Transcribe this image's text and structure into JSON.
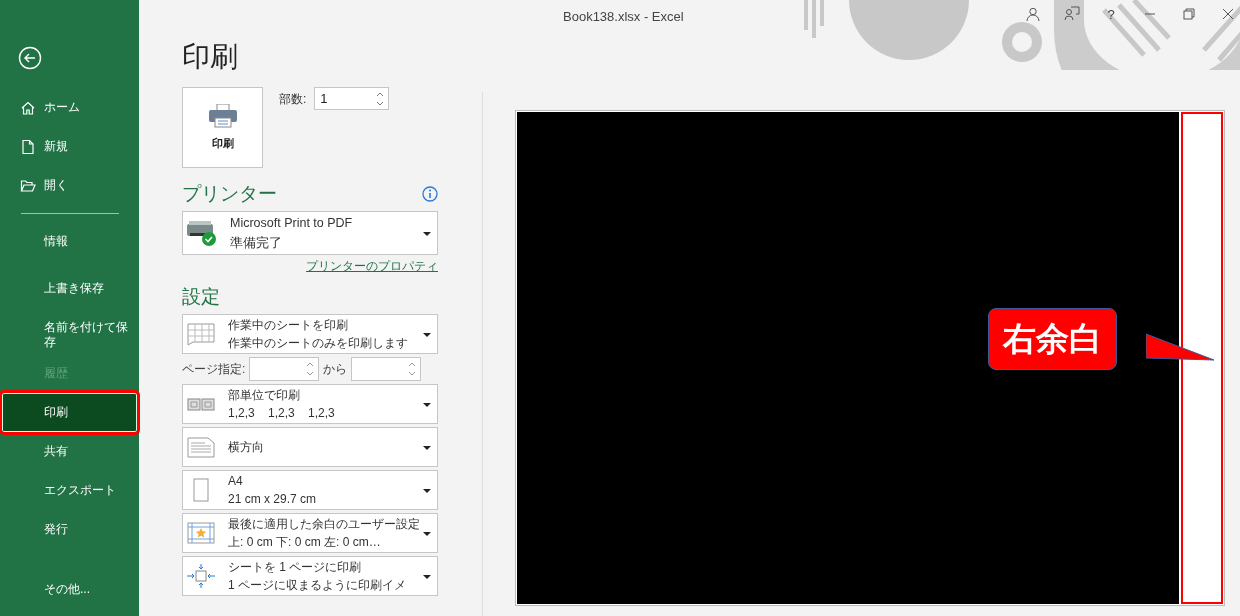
{
  "window": {
    "title": "Book138.xlsx  -  Excel",
    "help_label": "?"
  },
  "sidebar": {
    "items": [
      {
        "kind": "home",
        "label": "ホーム",
        "disabled": false,
        "selected": false
      },
      {
        "kind": "new",
        "label": "新規",
        "disabled": false,
        "selected": false
      },
      {
        "kind": "open",
        "label": "開く",
        "disabled": false,
        "selected": false
      },
      {
        "kind": "plain",
        "label": "情報",
        "disabled": false,
        "selected": false
      },
      {
        "kind": "plain",
        "label": "上書き保存",
        "disabled": false,
        "selected": false
      },
      {
        "kind": "plain",
        "label": "名前を付けて保存",
        "disabled": false,
        "selected": false
      },
      {
        "kind": "plain",
        "label": "履歴",
        "disabled": true,
        "selected": false
      },
      {
        "kind": "plain",
        "label": "印刷",
        "disabled": false,
        "selected": true
      },
      {
        "kind": "plain",
        "label": "共有",
        "disabled": false,
        "selected": false
      },
      {
        "kind": "plain",
        "label": "エクスポート",
        "disabled": false,
        "selected": false
      },
      {
        "kind": "plain",
        "label": "発行",
        "disabled": false,
        "selected": false
      },
      {
        "kind": "more",
        "label": "その他...",
        "disabled": false,
        "selected": false
      }
    ]
  },
  "print": {
    "title": "印刷",
    "print_button": "印刷",
    "copies": {
      "label": "部数:",
      "value": "1"
    }
  },
  "printer": {
    "heading": "プリンター",
    "name": "Microsoft Print to PDF",
    "status": "準備完了",
    "properties_link": "プリンターのプロパティ"
  },
  "settings": {
    "heading": "設定",
    "options": [
      {
        "kind": "sheets",
        "title": "作業中のシートを印刷",
        "subtitle": "作業中のシートのみを印刷します"
      },
      {
        "kind": "page-range",
        "label": "ページ指定:",
        "to_label": "から"
      },
      {
        "kind": "collate",
        "title": "部単位で印刷",
        "subtitle": "1,2,3    1,2,3    1,2,3"
      },
      {
        "kind": "orientation",
        "title": "横方向"
      },
      {
        "kind": "paper",
        "title": "A4",
        "subtitle": "21 cm x 29.7 cm"
      },
      {
        "kind": "margins",
        "title": "最後に適用した余白のユーザー設定",
        "subtitle": "上: 0 cm 下: 0 cm 左: 0 cm…"
      },
      {
        "kind": "scaling",
        "title": "シートを 1 ページに印刷",
        "subtitle": "1 ページに収まるように印刷イメ"
      }
    ]
  },
  "preview": {
    "callout": "右余白"
  }
}
